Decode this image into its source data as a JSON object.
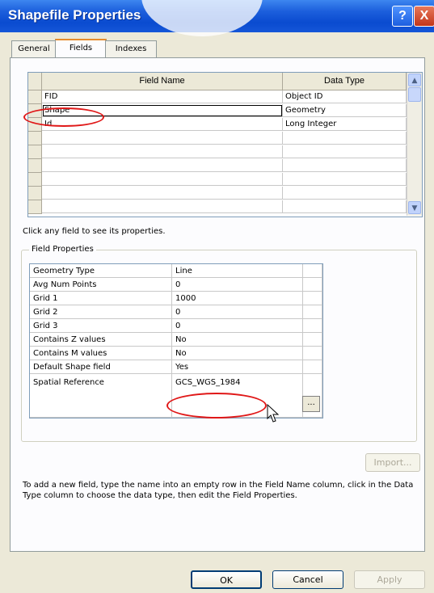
{
  "window": {
    "title": "Shapefile Properties"
  },
  "titlebar_buttons": {
    "help": "?",
    "close": "X"
  },
  "tabs": [
    {
      "label": "General"
    },
    {
      "label": "Fields"
    },
    {
      "label": "Indexes"
    }
  ],
  "fields_grid": {
    "headers": {
      "name": "Field Name",
      "type": "Data Type"
    },
    "rows": [
      {
        "name": "FID",
        "type": "Object ID"
      },
      {
        "name": "Shape",
        "type": "Geometry"
      },
      {
        "name": "Id",
        "type": "Long Integer"
      }
    ],
    "scroll_up": "▲",
    "scroll_down": "▼"
  },
  "hint_text": "Click any field to see its properties.",
  "field_properties": {
    "legend": "Field Properties",
    "rows": [
      {
        "label": "Geometry Type",
        "value": "Line"
      },
      {
        "label": "Avg Num Points",
        "value": "0"
      },
      {
        "label": "Grid 1",
        "value": "1000"
      },
      {
        "label": "Grid 2",
        "value": "0"
      },
      {
        "label": "Grid 3",
        "value": "0"
      },
      {
        "label": "Contains Z values",
        "value": "No"
      },
      {
        "label": "Contains M values",
        "value": "No"
      },
      {
        "label": "Default Shape field",
        "value": "Yes"
      },
      {
        "label": "Spatial Reference",
        "value": "GCS_WGS_1984"
      }
    ],
    "browse_button": "..."
  },
  "import_button": "Import...",
  "description": "To add a new field, type the name into an empty row in the Field Name column, click in the Data Type column to choose the data type, then edit the Field Properties.",
  "buttons": {
    "ok": "OK",
    "cancel": "Cancel",
    "apply": "Apply"
  },
  "colors": {
    "title_bar": "#0a4bd0",
    "annotation": "#e01818"
  }
}
